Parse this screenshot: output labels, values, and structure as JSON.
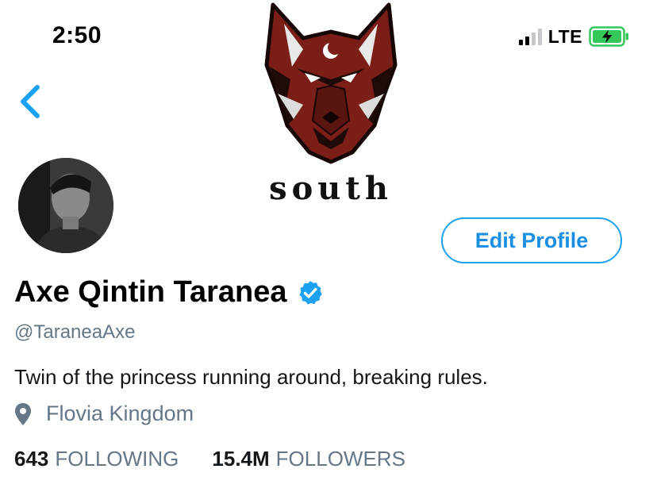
{
  "status_bar": {
    "time": "2:50",
    "network": "LTE",
    "signal_bars_filled": 2,
    "signal_bars_total": 4,
    "battery_state": "charging"
  },
  "nav": {
    "back_icon": "chevron-left-icon"
  },
  "banner": {
    "logo_icon": "wolf-head-icon",
    "brand_text": "south"
  },
  "profile": {
    "avatar_icon": "avatar-photo",
    "edit_button_label": "Edit Profile",
    "display_name": "Axe Qintin Taranea",
    "verified_icon": "verified-badge-icon",
    "handle": "@TaraneaAxe",
    "bio": "Twin of the princess running around, breaking rules.",
    "location_icon": "location-pin-icon",
    "location": "Flovia Kingdom",
    "following_count": "643",
    "following_label": "FOLLOWING",
    "followers_count": "15.4M",
    "followers_label": "FOLLOWERS"
  },
  "colors": {
    "accent": "#1da1f2",
    "secondary_text": "#657786",
    "battery_green": "#34c759",
    "logo_red": "#7a1e17"
  }
}
